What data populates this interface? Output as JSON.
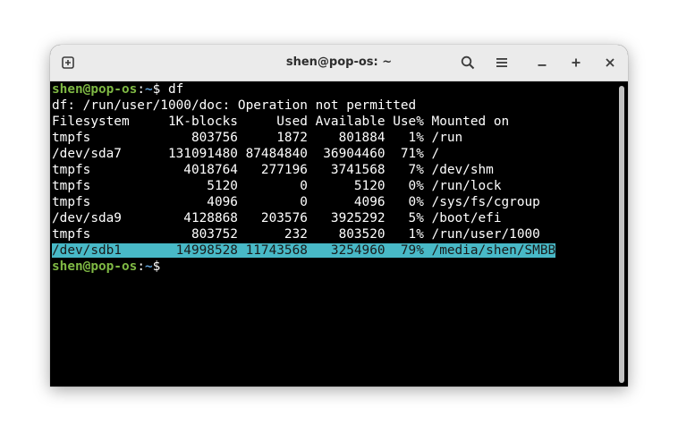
{
  "window": {
    "title": "shen@pop-os: ~"
  },
  "titlebar": {
    "new_tab_icon": "new-tab-icon",
    "search_icon": "search-icon",
    "menu_icon": "hamburger-menu-icon",
    "minimize_icon": "minimize-icon",
    "maximize_icon": "maximize-icon",
    "close_icon": "close-icon"
  },
  "terminal": {
    "prompt_user": "shen@pop-os",
    "prompt_colon": ":",
    "prompt_path": "~",
    "prompt_symbol": "$",
    "command": " df",
    "error_line": "df: /run/user/1000/doc: Operation not permitted",
    "header_line": "Filesystem     1K-blocks     Used Available Use% Mounted on",
    "rows": [
      "tmpfs             803756     1872    801884   1% /run",
      "/dev/sda7      131091480 87484840  36904460  71% /",
      "tmpfs            4018764   277196   3741568   7% /dev/shm",
      "tmpfs               5120        0      5120   0% /run/lock",
      "tmpfs               4096        0      4096   0% /sys/fs/cgroup",
      "/dev/sda9        4128868   203576   3925292   5% /boot/efi",
      "tmpfs             803752      232    803520   1% /run/user/1000"
    ],
    "highlight_row": "/dev/sdb1       14998528 11743568   3254960  79% /media/shen/SMBB"
  },
  "colors": {
    "prompt_user": "#7fb944",
    "prompt_path": "#5f9fd6",
    "highlight_bg": "#48b9c7",
    "terminal_bg": "#000000",
    "titlebar_bg": "#ebebeb"
  }
}
